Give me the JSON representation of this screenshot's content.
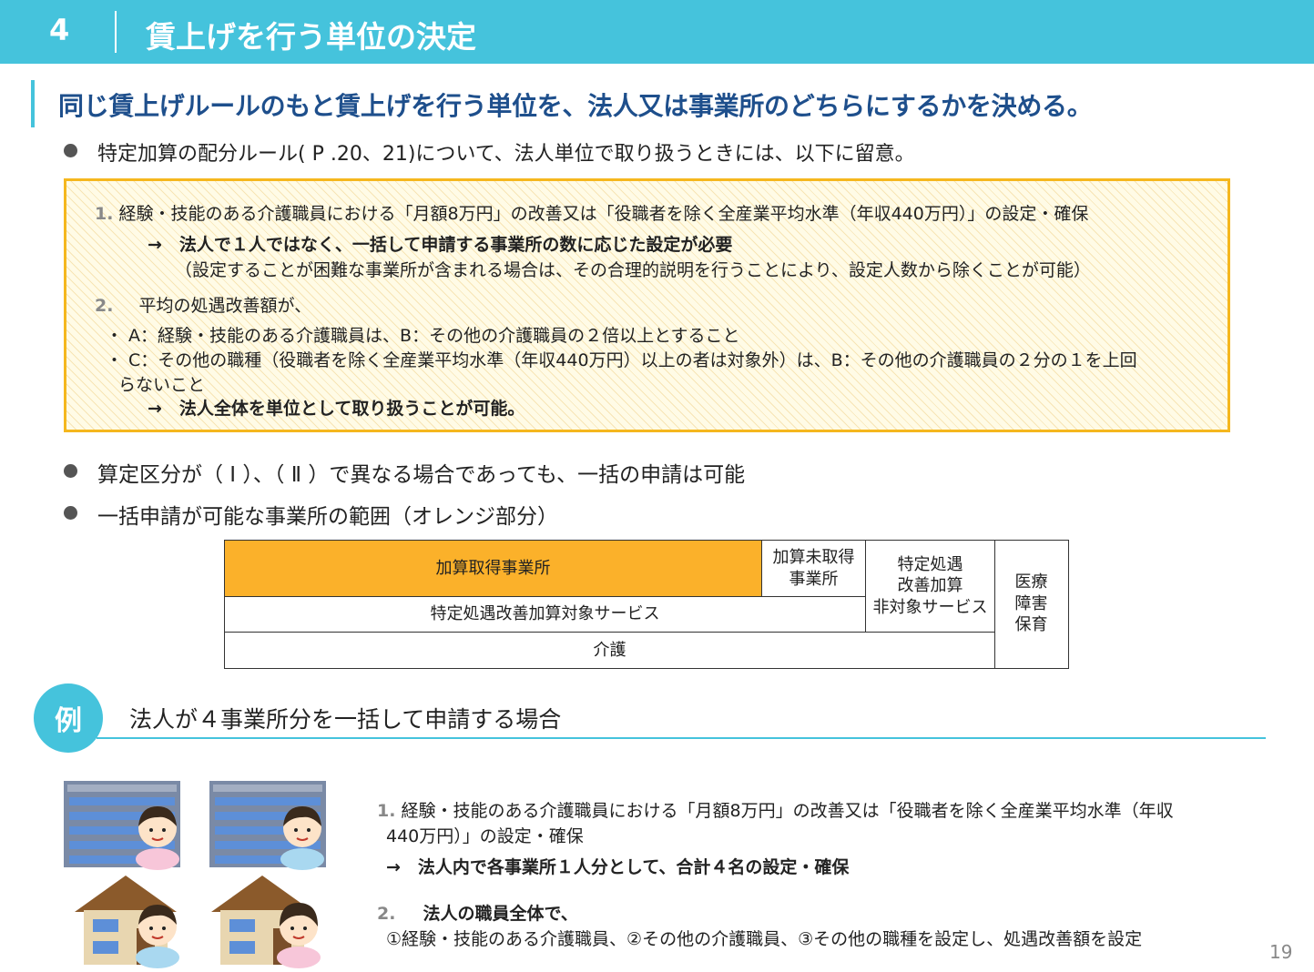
{
  "header": {
    "section_number": "4",
    "section_title": "賃上げを行う単位の決定"
  },
  "headline": "同じ賃上げルールのもと賃上げを行う単位を、法人又は事業所のどちらにするかを決める。",
  "bullets": [
    "特定加算の配分ルール( P .20、21)について、法人単位で取り扱うときには、以下に留意。",
    "算定区分が（ Ⅰ ）、（ Ⅱ ）で異なる場合であっても、一括の申請は可能",
    "一括申請が可能な事業所の範囲（オレンジ部分）"
  ],
  "notice_box": {
    "item1_num": "1.",
    "item1_text": "経験・技能のある介護職員における「月額8万円」の改善又は「役職者を除く全産業平均水準（年収440万円）」の設定・確保",
    "item1_result": "→　法人で１人ではなく、一括して申請する事業所の数に応じた設定が必要",
    "item1_note": "（設定することが困難な事業所が含まれる場合は、その合理的説明を行うことにより、設定人数から除くことが可能）",
    "item2_num": "2.",
    "item2_text": "平均の処遇改善額が、",
    "item2_a": "・ A：経験・技能のある介護職員は、B：その他の介護職員の２倍以上とすること",
    "item2_c1": "・ C：その他の職種（役職者を除く全産業平均水準（年収440万円）以上の者は対象外）は、B：その他の介護職員の２分の１を上回",
    "item2_c2": "らないこと",
    "item2_result": "→　法人全体を単位として取り扱うことが可能。"
  },
  "scope_table": {
    "acquired": "加算取得事業所",
    "not_acquired_1": "加算未取得",
    "not_acquired_2": "事業所",
    "non_target_1": "特定処遇",
    "non_target_2": "改善加算",
    "non_target_3": "非対象サービス",
    "other_1": "医療",
    "other_2": "障害",
    "other_3": "保育",
    "target_services": "特定処遇改善加算対象サービス",
    "care": "介護"
  },
  "colors": {
    "accent": "#45c3dc",
    "headline": "#1e4f8c",
    "highlight_orange": "#fbb12a",
    "box_border": "#f5b71e"
  },
  "example": {
    "badge": "例",
    "title": "法人が４事業所分を一括して申請する場合",
    "item1_num": "1.",
    "item1_line1": "経験・技能のある介護職員における「月額8万円」の改善又は「役職者を除く全産業平均水準（年収",
    "item1_line2": "440万円）」の設定・確保",
    "item1_result": "→　法人内で各事業所１人分として、合計４名の設定・確保",
    "item2_num": "2.",
    "item2_heading": "法人の職員全体で、",
    "item2_text": "①経験・技能のある介護職員、②その他の介護職員、③その他の職種を設定し、処遇改善額を設定"
  },
  "page_number": "19"
}
